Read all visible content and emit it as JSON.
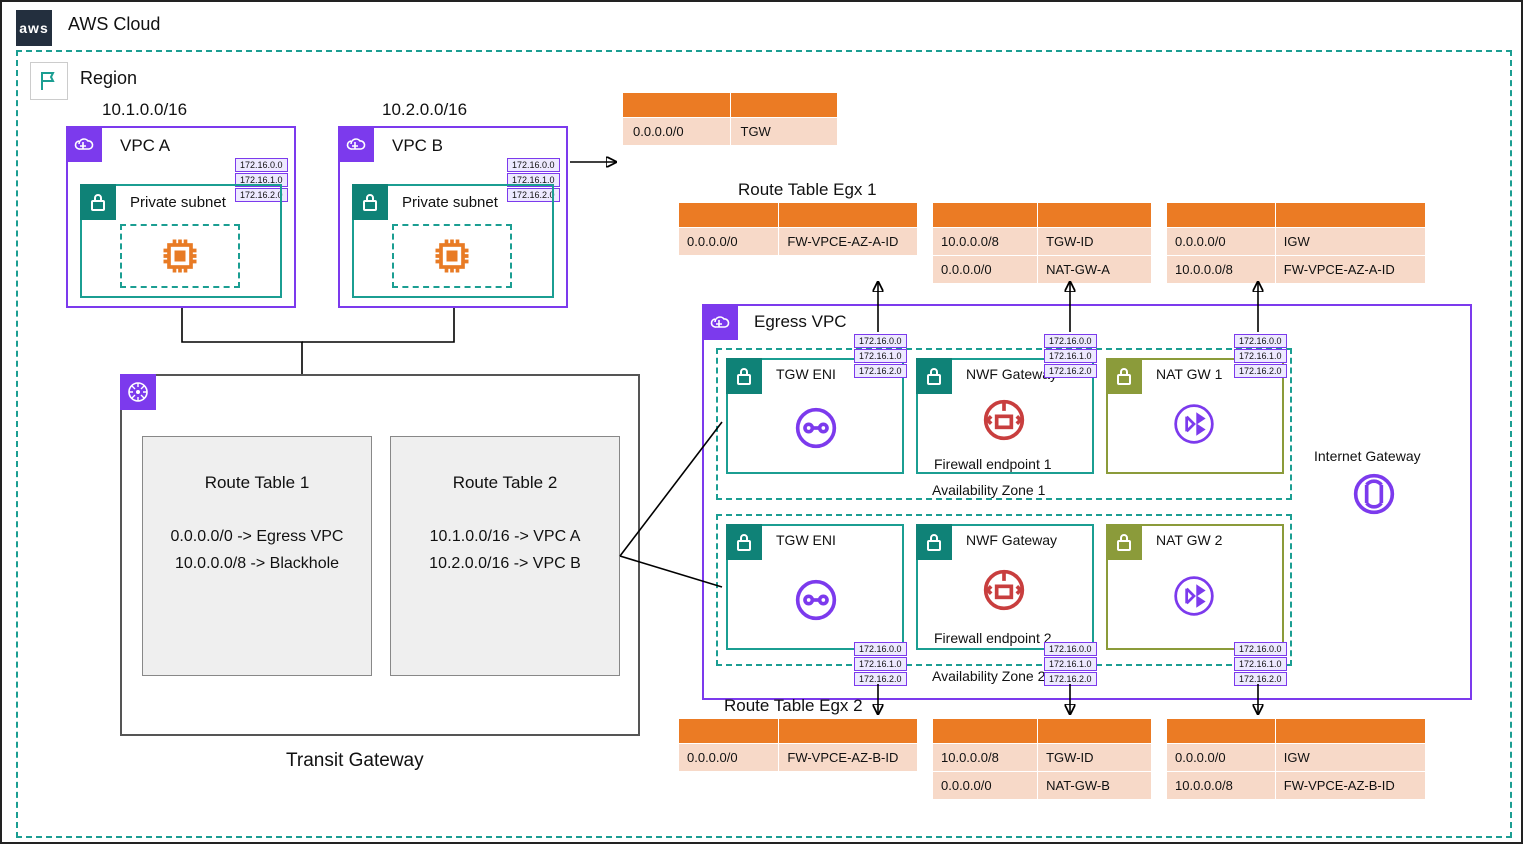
{
  "cloud_label": "AWS Cloud",
  "region_label": "Region",
  "vpc_a": {
    "label": "VPC A",
    "cidr": "10.1.0.0/16",
    "subnet_label": "Private subnet"
  },
  "vpc_b": {
    "label": "VPC B",
    "cidr": "10.2.0.0/16",
    "subnet_label": "Private subnet"
  },
  "cidr_tags": [
    "172.16.0.0",
    "172.16.1.0",
    "172.16.2.0"
  ],
  "top_vpc_rt": {
    "dest": "0.0.0.0/0",
    "target": "TGW"
  },
  "egress_vpc_label": "Egress VPC",
  "egress": {
    "egx1_label": "Route Table Egx 1",
    "egx2_label": "Route Table Egx 2",
    "tgw_eni_label": "TGW ENI",
    "nwf_label": "NWF Gateway",
    "nat1_label": "NAT GW 1",
    "nat2_label": "NAT GW 2",
    "fw1_label": "Firewall endpoint 1",
    "fw2_label": "Firewall endpoint 2",
    "az1_label": "Availability Zone 1",
    "az2_label": "Availability Zone 2",
    "igw_label": "Internet Gateway"
  },
  "rt_egx1_1": [
    [
      "0.0.0.0/0",
      "FW-VPCE-AZ-A-ID"
    ]
  ],
  "rt_egx1_2": [
    [
      "10.0.0.0/8",
      "TGW-ID"
    ],
    [
      "0.0.0.0/0",
      "NAT-GW-A"
    ]
  ],
  "rt_egx1_3": [
    [
      "0.0.0.0/0",
      "IGW"
    ],
    [
      "10.0.0.0/8",
      "FW-VPCE-AZ-A-ID"
    ]
  ],
  "rt_egx2_1": [
    [
      "0.0.0.0/0",
      "FW-VPCE-AZ-B-ID"
    ]
  ],
  "rt_egx2_2": [
    [
      "10.0.0.0/8",
      "TGW-ID"
    ],
    [
      "0.0.0.0/0",
      "NAT-GW-B"
    ]
  ],
  "rt_egx2_3": [
    [
      "0.0.0.0/0",
      "IGW"
    ],
    [
      "10.0.0.0/8",
      "FW-VPCE-AZ-B-ID"
    ]
  ],
  "tgw_label": "Transit Gateway",
  "tgw_rt1": {
    "title": "Route Table 1",
    "rows": [
      "0.0.0.0/0 -> Egress VPC",
      "10.0.0.0/8 -> Blackhole"
    ]
  },
  "tgw_rt2": {
    "title": "Route Table 2",
    "rows": [
      "10.1.0.0/16 -> VPC A",
      "10.2.0.0/16 -> VPC B"
    ]
  }
}
